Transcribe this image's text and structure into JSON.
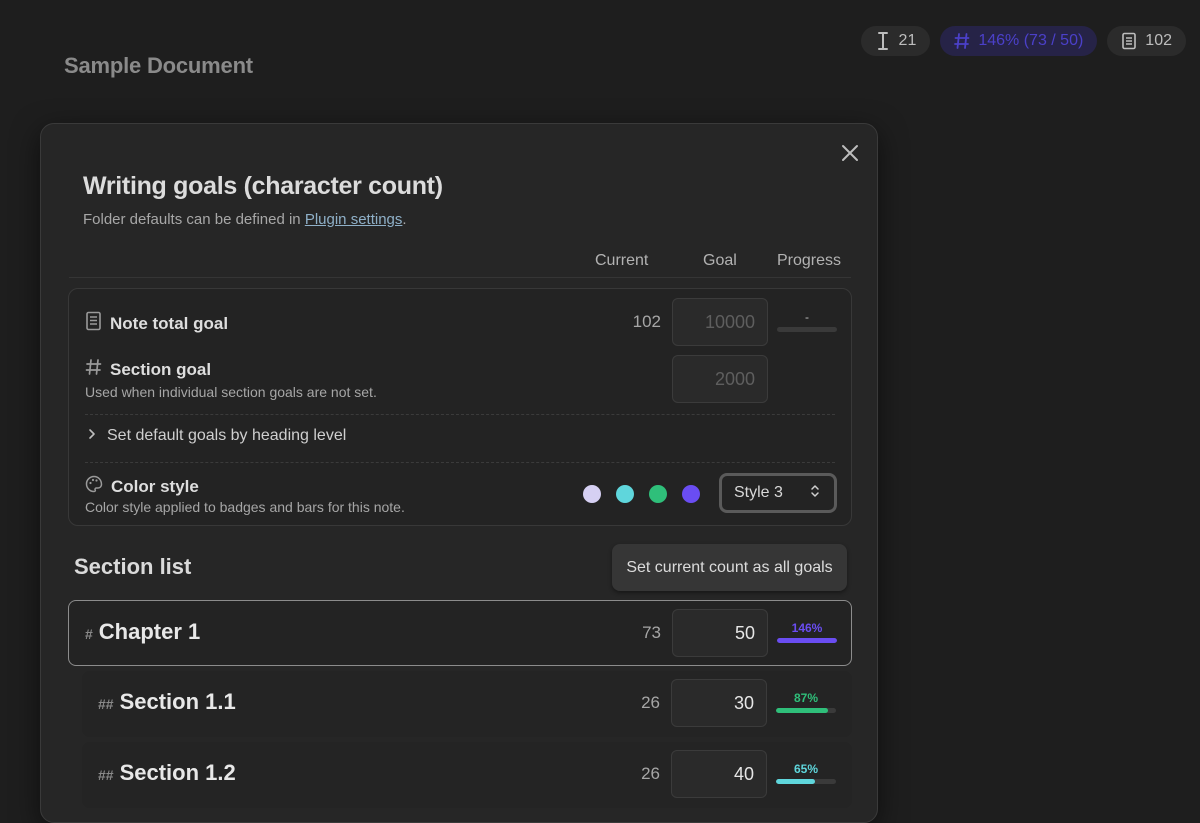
{
  "document": {
    "title": "Sample Document"
  },
  "status_bar": {
    "cursor_count": "21",
    "section_progress": "146% (73 / 50)",
    "note_count": "102"
  },
  "modal": {
    "title": "Writing goals (character count)",
    "subtitle_prefix": "Folder defaults can be defined in ",
    "subtitle_link": "Plugin settings",
    "subtitle_suffix": ".",
    "columns": {
      "current": "Current",
      "goal": "Goal",
      "progress": "Progress"
    },
    "note_total": {
      "label": "Note total goal",
      "current": "102",
      "goal_placeholder": "10000",
      "progress": "-"
    },
    "section_goal": {
      "label": "Section goal",
      "description": "Used when individual section goals are not set.",
      "goal_placeholder": "2000"
    },
    "heading_defaults": {
      "label": "Set default goals by heading level"
    },
    "color_style": {
      "label": "Color style",
      "description": "Color style applied to badges and bars for this note.",
      "swatches": [
        "#d6d0f3",
        "#5fd6dc",
        "#2fbf7a",
        "#6a4df2"
      ],
      "selected": "Style 3"
    },
    "section_list": {
      "title": "Section list",
      "set_all_button": "Set current count as all goals",
      "rows": [
        {
          "hashes": "#",
          "name": "Chapter 1",
          "current": "73",
          "goal": "50",
          "percent": "146%",
          "progress": 1.0,
          "color": "#6a4df2"
        },
        {
          "hashes": "##",
          "name": "Section 1.1",
          "current": "26",
          "goal": "30",
          "percent": "87%",
          "progress": 0.87,
          "color": "#2fbf7a"
        },
        {
          "hashes": "##",
          "name": "Section 1.2",
          "current": "26",
          "goal": "40",
          "percent": "65%",
          "progress": 0.65,
          "color": "#5fd6dc"
        }
      ]
    }
  }
}
